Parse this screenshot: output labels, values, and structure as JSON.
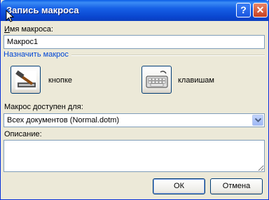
{
  "dialog": {
    "title": "Запись макроса",
    "help_button": "?",
    "close_button": "✕"
  },
  "macro_name": {
    "label": "Имя макроса:",
    "value": "Макрос1"
  },
  "assign": {
    "group_label": "Назначить макрос",
    "button_label": "кнопке",
    "keyboard_label": "клавишам"
  },
  "store_in": {
    "label": "Макрос доступен для:",
    "selected": "Всех документов (Normal.dotm)"
  },
  "description": {
    "label": "Описание:",
    "value": ""
  },
  "footer": {
    "ok_label": "ОК",
    "cancel_label": "Отмена"
  },
  "colors": {
    "title_bar": "#0a46d0",
    "group_label": "#0046d5",
    "dialog_bg": "#ece9d8"
  }
}
